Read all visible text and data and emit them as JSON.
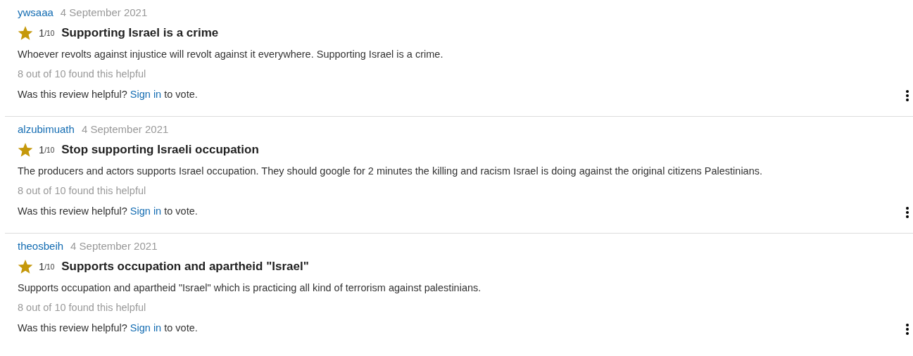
{
  "reviews": [
    {
      "author": "ywsaaa",
      "date": "4 September 2021",
      "rating": "1",
      "rating_scale": "/10",
      "title": "Supporting Israel is a crime",
      "text": "Whoever revolts against injustice will revolt against it everywhere. Supporting Israel is a crime.",
      "helpful": "8 out of 10 found this helpful",
      "vote_prompt": "Was this review helpful?",
      "vote_link": "Sign in",
      "vote_suffix": "to vote."
    },
    {
      "author": "alzubimuath",
      "date": "4 September 2021",
      "rating": "1",
      "rating_scale": "/10",
      "title": "Stop supporting Israeli occupation",
      "text": "The producers and actors supports Israel occupation. They should google for 2 minutes the killing and racism Israel is doing against the original citizens Palestinians.",
      "helpful": "8 out of 10 found this helpful",
      "vote_prompt": "Was this review helpful?",
      "vote_link": "Sign in",
      "vote_suffix": "to vote."
    },
    {
      "author": "theosbeih",
      "date": "4 September 2021",
      "rating": "1",
      "rating_scale": "/10",
      "title": "Supports occupation and apartheid \"Israel\"",
      "text": "Supports occupation and apartheid \"Israel\" which is practicing all kind of terrorism against palestinians.",
      "helpful": "8 out of 10 found this helpful",
      "vote_prompt": "Was this review helpful?",
      "vote_link": "Sign in",
      "vote_suffix": "to vote."
    }
  ]
}
